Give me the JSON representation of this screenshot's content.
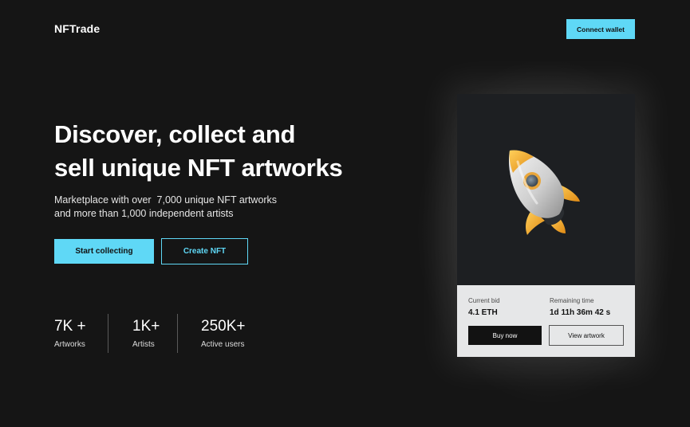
{
  "header": {
    "logo": "NFTrade",
    "connect_label": "Connect wallet"
  },
  "hero": {
    "title_line1": "Discover, collect and",
    "title_line2": "sell unique NFT artworks",
    "subtitle_line1": "Marketplace with over  7,000 unique NFT artworks",
    "subtitle_line2": "and more than 1,000 independent artists",
    "primary_label": "Start collecting",
    "secondary_label": "Create NFT"
  },
  "stats": [
    {
      "value": "7K +",
      "label": "Artworks"
    },
    {
      "value": "1K+",
      "label": "Artists"
    },
    {
      "value": "250K+",
      "label": "Active users"
    }
  ],
  "card": {
    "image_icon": "rocket-icon",
    "bid_label": "Current bid",
    "bid_value": "4.1 ETH",
    "time_label": "Remaining time",
    "time_value": "1d 11h 36m 42 s",
    "buy_label": "Buy now",
    "view_label": "View artwork"
  },
  "colors": {
    "accent": "#5fd8f6",
    "background": "#151515",
    "card_info_bg": "#e6e7e8"
  }
}
